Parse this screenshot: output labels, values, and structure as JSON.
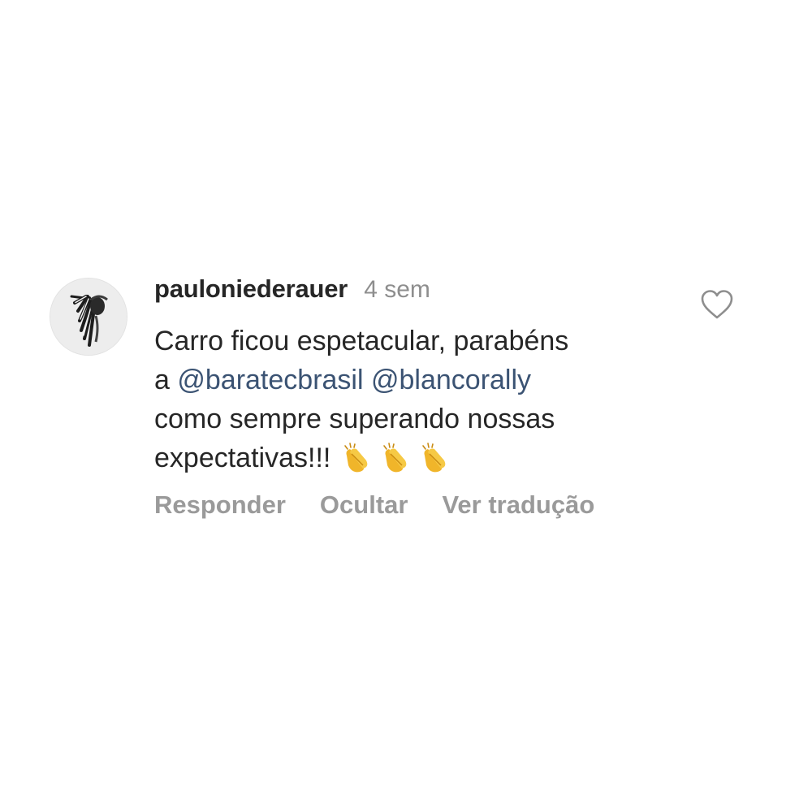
{
  "comment": {
    "username": "pauloniederauer",
    "time": "4 sem",
    "text": {
      "line1": "Carro ficou espetacular, parabéns",
      "line2_prefix": "a ",
      "mention1": "@baratecbrasil",
      "mention2": "@blancorally",
      "line3": "como sempre superando nossas",
      "line4": "expectativas!!!"
    },
    "emojis": [
      "clapping-hands",
      "clapping-hands",
      "clapping-hands"
    ],
    "actions": {
      "reply": "Responder",
      "hide": "Ocultar",
      "translate": "Ver tradução"
    },
    "like_icon": "heart-outline",
    "colors": {
      "text": "#262626",
      "muted": "#8e8e8e",
      "mention": "#3b5373"
    }
  }
}
